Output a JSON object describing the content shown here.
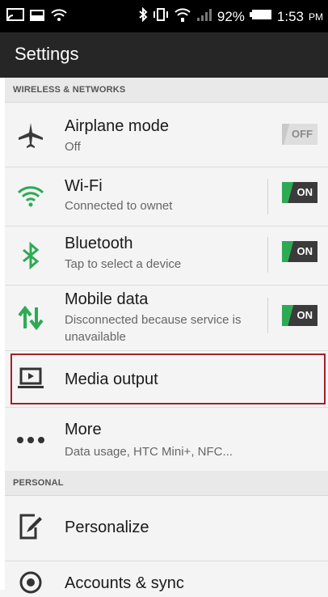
{
  "status_bar": {
    "battery_percent": "92%",
    "time": "1:53",
    "ampm": "PM",
    "icons": [
      "screen-cast-icon",
      "image-icon",
      "wifi-icon",
      "bluetooth-icon",
      "vibrate-icon",
      "wifi-signal-icon",
      "cell-signal-icon",
      "battery-icon"
    ]
  },
  "action_bar": {
    "title": "Settings"
  },
  "sections": {
    "wireless": "WIRELESS & NETWORKS",
    "personal": "PERSONAL"
  },
  "items": {
    "airplane": {
      "title": "Airplane mode",
      "subtitle": "Off",
      "toggle": "OFF",
      "icon": "airplane-icon"
    },
    "wifi": {
      "title": "Wi-Fi",
      "subtitle": "Connected to ownet",
      "toggle": "ON",
      "icon": "wifi-icon"
    },
    "bluetooth": {
      "title": "Bluetooth",
      "subtitle": "Tap to select a device",
      "toggle": "ON",
      "icon": "bluetooth-icon"
    },
    "mobile_data": {
      "title": "Mobile data",
      "subtitle_line1": "Disconnected because service is",
      "subtitle_line2": "unavailable",
      "toggle": "ON",
      "icon": "arrows-updown-icon"
    },
    "media_output": {
      "title": "Media output",
      "icon": "media-output-icon"
    },
    "more": {
      "title": "More",
      "subtitle": "Data usage, HTC Mini+, NFC...",
      "icon": "more-dots-icon"
    },
    "personalize": {
      "title": "Personalize",
      "icon": "personalize-icon"
    },
    "accounts": {
      "title": "Accounts & sync",
      "icon": "sync-icon"
    }
  },
  "colors": {
    "accent_green": "#2eaa55",
    "highlight_red": "#a31f2a",
    "action_bar": "#262626"
  }
}
